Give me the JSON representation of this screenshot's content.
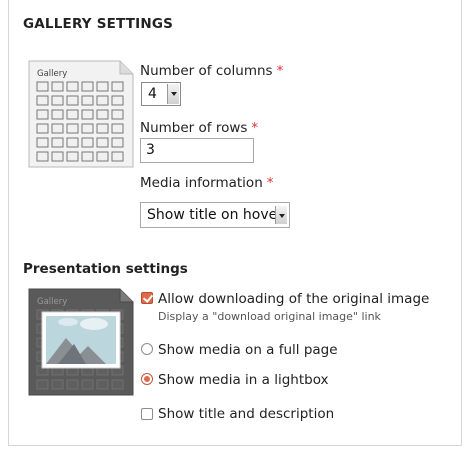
{
  "section": {
    "title": "GALLERY SETTINGS"
  },
  "gallery_thumbnail": {
    "caption": "Gallery"
  },
  "presentation_thumbnail": {
    "caption": "Gallery"
  },
  "fields": {
    "columns": {
      "label": "Number of columns",
      "required_mark": "*",
      "value": "4"
    },
    "rows": {
      "label": "Number of rows",
      "required_mark": "*",
      "value": "3"
    },
    "media_info": {
      "label": "Media information",
      "required_mark": "*",
      "value": "Show title on hover"
    }
  },
  "presentation": {
    "title": "Presentation settings",
    "allow_download": {
      "label": "Allow downloading of the original image",
      "hint": "Display a \"download original image\" link",
      "checked": true
    },
    "full_page": {
      "label": "Show media on a full page",
      "selected": false
    },
    "lightbox": {
      "label": "Show media in a lightbox",
      "selected": true
    },
    "title_desc": {
      "label": "Show title and description",
      "checked": false
    }
  },
  "colors": {
    "accent": "#e0694a",
    "required": "#d9342b",
    "border": "#d6d6d6"
  }
}
